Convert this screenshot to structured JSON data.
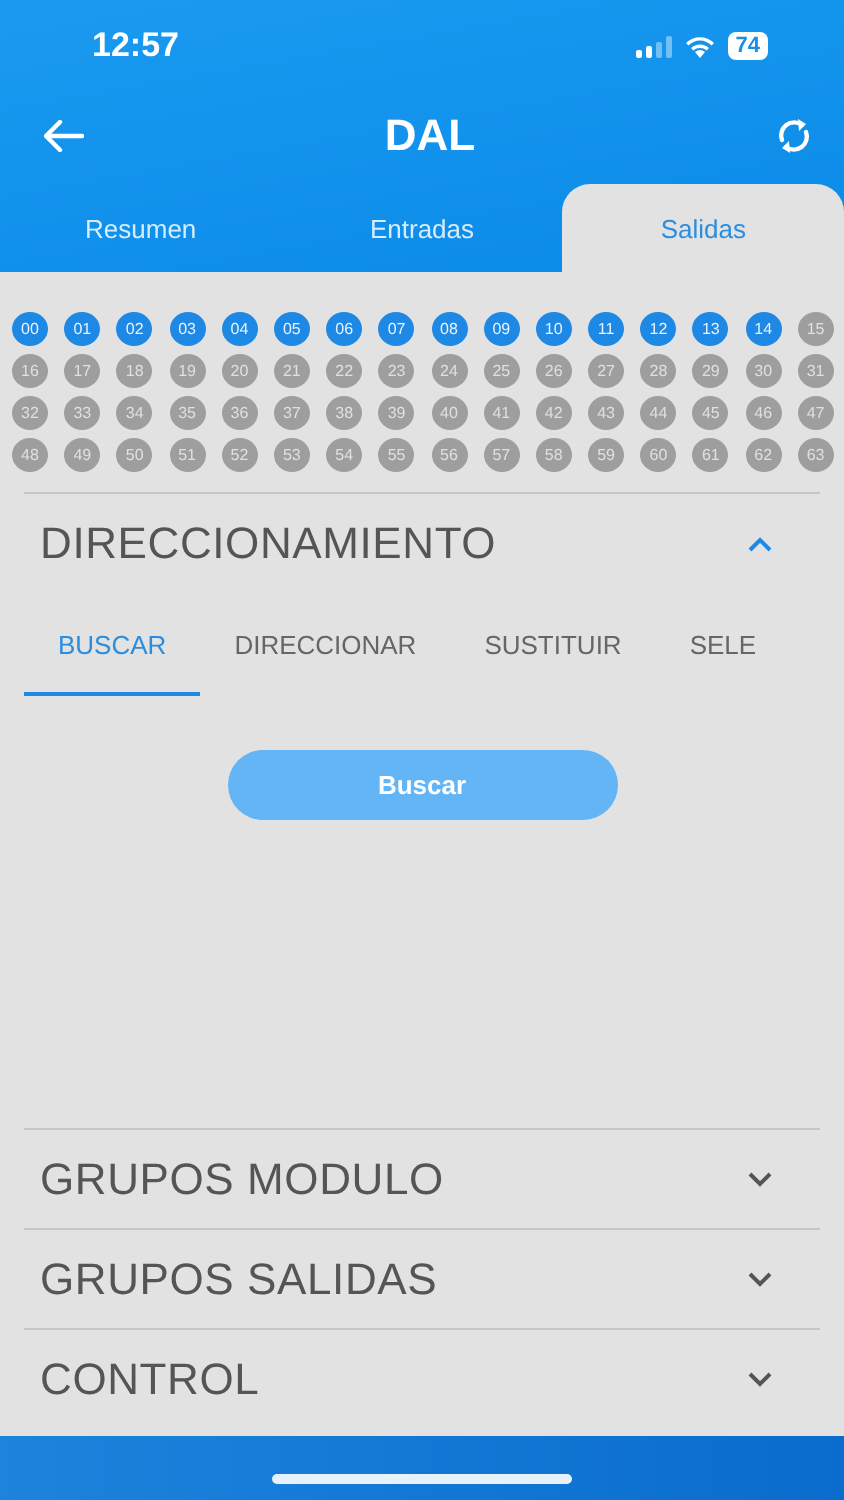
{
  "status_bar": {
    "time": "12:57",
    "battery": "74"
  },
  "header": {
    "title": "DAL"
  },
  "tabs": [
    {
      "label": "Resumen",
      "selected": false
    },
    {
      "label": "Entradas",
      "selected": false
    },
    {
      "label": "Salidas",
      "selected": true
    }
  ],
  "outputs": [
    {
      "label": "00",
      "on": true
    },
    {
      "label": "01",
      "on": true
    },
    {
      "label": "02",
      "on": true
    },
    {
      "label": "03",
      "on": true
    },
    {
      "label": "04",
      "on": true
    },
    {
      "label": "05",
      "on": true
    },
    {
      "label": "06",
      "on": true
    },
    {
      "label": "07",
      "on": true
    },
    {
      "label": "08",
      "on": true
    },
    {
      "label": "09",
      "on": true
    },
    {
      "label": "10",
      "on": true
    },
    {
      "label": "11",
      "on": true
    },
    {
      "label": "12",
      "on": true
    },
    {
      "label": "13",
      "on": true
    },
    {
      "label": "14",
      "on": true
    },
    {
      "label": "15",
      "on": false
    },
    {
      "label": "16",
      "on": false
    },
    {
      "label": "17",
      "on": false
    },
    {
      "label": "18",
      "on": false
    },
    {
      "label": "19",
      "on": false
    },
    {
      "label": "20",
      "on": false
    },
    {
      "label": "21",
      "on": false
    },
    {
      "label": "22",
      "on": false
    },
    {
      "label": "23",
      "on": false
    },
    {
      "label": "24",
      "on": false
    },
    {
      "label": "25",
      "on": false
    },
    {
      "label": "26",
      "on": false
    },
    {
      "label": "27",
      "on": false
    },
    {
      "label": "28",
      "on": false
    },
    {
      "label": "29",
      "on": false
    },
    {
      "label": "30",
      "on": false
    },
    {
      "label": "31",
      "on": false
    },
    {
      "label": "32",
      "on": false
    },
    {
      "label": "33",
      "on": false
    },
    {
      "label": "34",
      "on": false
    },
    {
      "label": "35",
      "on": false
    },
    {
      "label": "36",
      "on": false
    },
    {
      "label": "37",
      "on": false
    },
    {
      "label": "38",
      "on": false
    },
    {
      "label": "39",
      "on": false
    },
    {
      "label": "40",
      "on": false
    },
    {
      "label": "41",
      "on": false
    },
    {
      "label": "42",
      "on": false
    },
    {
      "label": "43",
      "on": false
    },
    {
      "label": "44",
      "on": false
    },
    {
      "label": "45",
      "on": false
    },
    {
      "label": "46",
      "on": false
    },
    {
      "label": "47",
      "on": false
    },
    {
      "label": "48",
      "on": false
    },
    {
      "label": "49",
      "on": false
    },
    {
      "label": "50",
      "on": false
    },
    {
      "label": "51",
      "on": false
    },
    {
      "label": "52",
      "on": false
    },
    {
      "label": "53",
      "on": false
    },
    {
      "label": "54",
      "on": false
    },
    {
      "label": "55",
      "on": false
    },
    {
      "label": "56",
      "on": false
    },
    {
      "label": "57",
      "on": false
    },
    {
      "label": "58",
      "on": false
    },
    {
      "label": "59",
      "on": false
    },
    {
      "label": "60",
      "on": false
    },
    {
      "label": "61",
      "on": false
    },
    {
      "label": "62",
      "on": false
    },
    {
      "label": "63",
      "on": false
    }
  ],
  "sections": [
    {
      "title": "DIRECCIONAMIENTO",
      "expanded": true,
      "subtabs": [
        {
          "label": "BUSCAR",
          "selected": true
        },
        {
          "label": "DIRECCIONAR",
          "selected": false
        },
        {
          "label": "SUSTITUIR",
          "selected": false
        },
        {
          "label": "SELE",
          "selected": false
        }
      ],
      "button": "Buscar"
    },
    {
      "title": "GRUPOS MODULO",
      "expanded": false
    },
    {
      "title": "GRUPOS SALIDAS",
      "expanded": false
    },
    {
      "title": "CONTROL",
      "expanded": false
    }
  ]
}
